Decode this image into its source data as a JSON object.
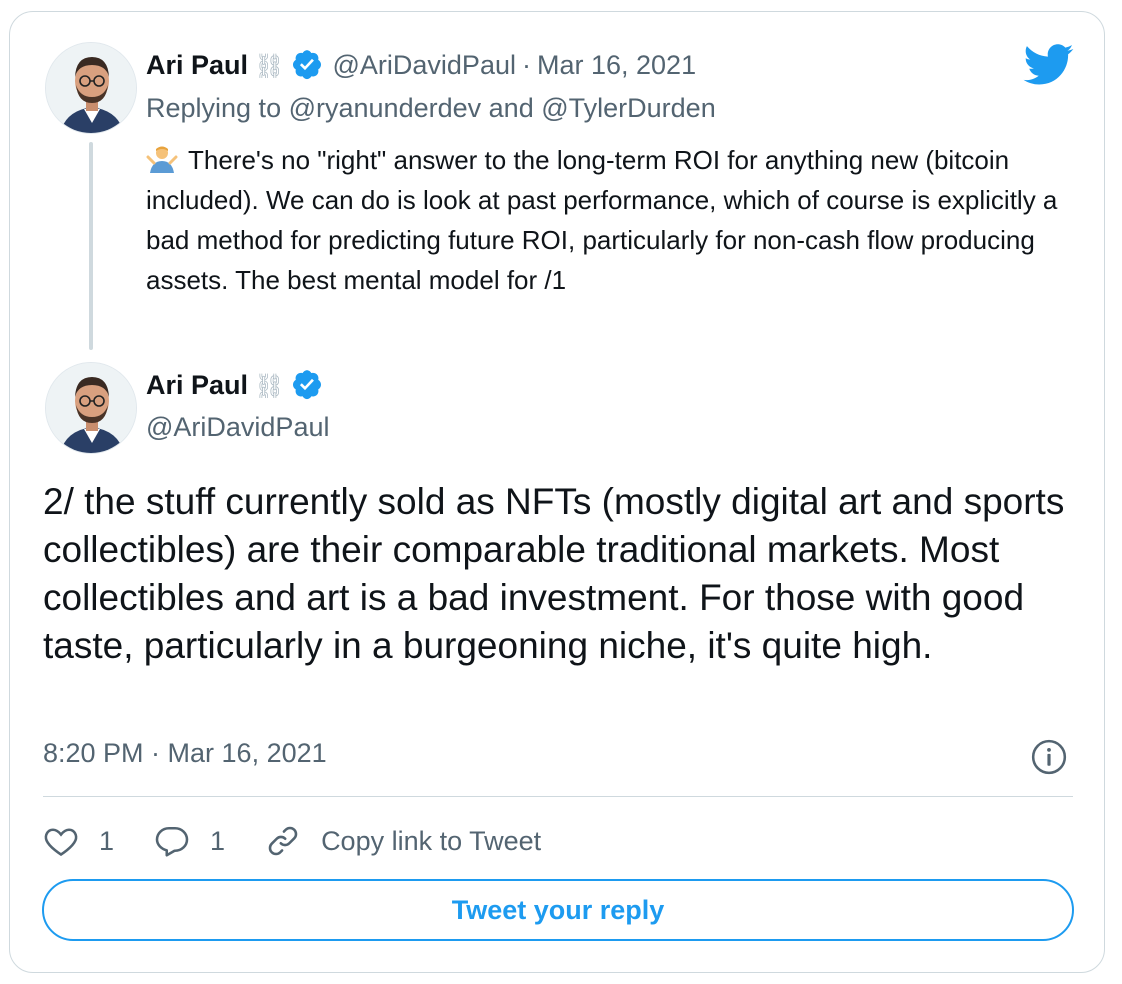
{
  "quoted_tweet": {
    "author_name": "Ari Paul",
    "chain_emoji": "⛓",
    "handle": "@AriDavidPaul",
    "separator": "·",
    "date": "Mar 16, 2021",
    "replying_prefix": "Replying to",
    "mention_1": "@ryanunderdev",
    "replying_and": "and",
    "mention_2": "@TylerDurden",
    "text": "There's no \"right\" answer to the long-term ROI for anything new (bitcoin included).  We can do is look at past performance, which of course is explicitly a bad method for predicting future ROI, particularly for non-cash flow producing assets.  The best mental model for /1"
  },
  "main_tweet": {
    "author_name": "Ari Paul",
    "chain_emoji": "⛓",
    "handle": "@AriDavidPaul",
    "text": "2/ the stuff currently sold as NFTs (mostly digital art and sports collectibles) are their comparable traditional markets.  Most collectibles and art is a bad investment.  For those with good taste, particularly in a burgeoning niche, it's quite high.",
    "timestamp": "8:20 PM · Mar 16, 2021"
  },
  "actions": {
    "like_count": "1",
    "reply_count": "1",
    "copy_link_label": "Copy link to Tweet"
  },
  "reply_button_label": "Tweet your reply",
  "colors": {
    "accent": "#1d9bf0",
    "muted_text": "#536471",
    "border": "#cfd9de"
  }
}
